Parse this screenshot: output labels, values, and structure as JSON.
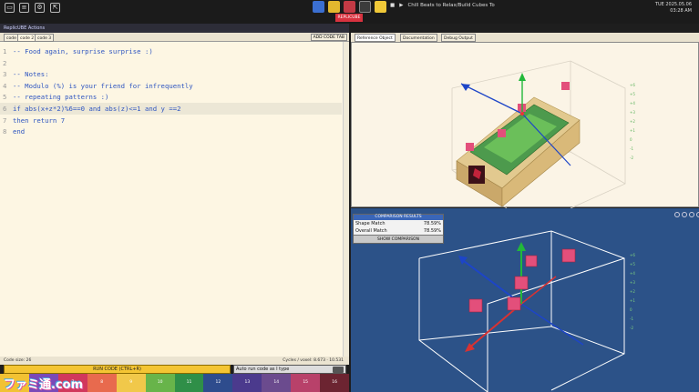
{
  "topbar": {
    "icons": [
      "folder-icon",
      "settings-icon",
      "gear-icon",
      "exit-icon"
    ],
    "replicube_tab": "REPLICUBE",
    "music_title": "Chill Beats to Relax/Build Cubes To",
    "clock_date": "TUE 2025.05.06",
    "clock_time": "03:28 AM"
  },
  "editor": {
    "title": "ReplicUBE Actions",
    "tabs": [
      "code",
      "code 2",
      "code 3"
    ],
    "active_tab": "code 2",
    "add_tab_label": "ADD CODE TAB",
    "lines": [
      {
        "n": "1",
        "text": "-- Food again, surprise surprise :)"
      },
      {
        "n": "2",
        "text": ""
      },
      {
        "n": "3",
        "text": "-- Notes:"
      },
      {
        "n": "4",
        "text": "-- Modulo (%) is your friend for infrequently"
      },
      {
        "n": "5",
        "text": "-- repeating patterns :)"
      },
      {
        "n": "6",
        "text": "if abs(x+z*2)%6==0 and abs(z)<=1 and y ==2"
      },
      {
        "n": "7",
        "text": "then return 7"
      },
      {
        "n": "8",
        "text": "end"
      }
    ],
    "code_size_label": "Code size: 26",
    "cycles_label": "Cycles / voxel: 8.673 · 10.531",
    "run_label": "RUN CODE (CTRL+R)",
    "autorun_label": "Auto run code as I type"
  },
  "palette": [
    {
      "n": "",
      "color": "#f2c233"
    },
    {
      "n": "6",
      "color": "#7a49b8"
    },
    {
      "n": "7",
      "color": "#d1385c"
    },
    {
      "n": "8",
      "color": "#e86a4e"
    },
    {
      "n": "9",
      "color": "#f1c84a"
    },
    {
      "n": "10",
      "color": "#68b44a"
    },
    {
      "n": "11",
      "color": "#2f8f48"
    },
    {
      "n": "12",
      "color": "#2e4c8d"
    },
    {
      "n": "13",
      "color": "#4b3a8d"
    },
    {
      "n": "14",
      "color": "#6b4b8e"
    },
    {
      "n": "15",
      "color": "#b8416a"
    },
    {
      "n": "16",
      "color": "#6c2431"
    }
  ],
  "viewer": {
    "tabs": [
      "Reference Object",
      "Documentation",
      "Debug Output"
    ],
    "active_tab": "Reference Object"
  },
  "comparison": {
    "title": "COMPARISON RESULTS",
    "shape_label": "Shape Match",
    "shape_value": "78.59%",
    "overall_label": "Overall Match",
    "overall_value": "78.59%",
    "show_button": "SHOW COMPARISON"
  },
  "watermark": "ファミ通.com"
}
